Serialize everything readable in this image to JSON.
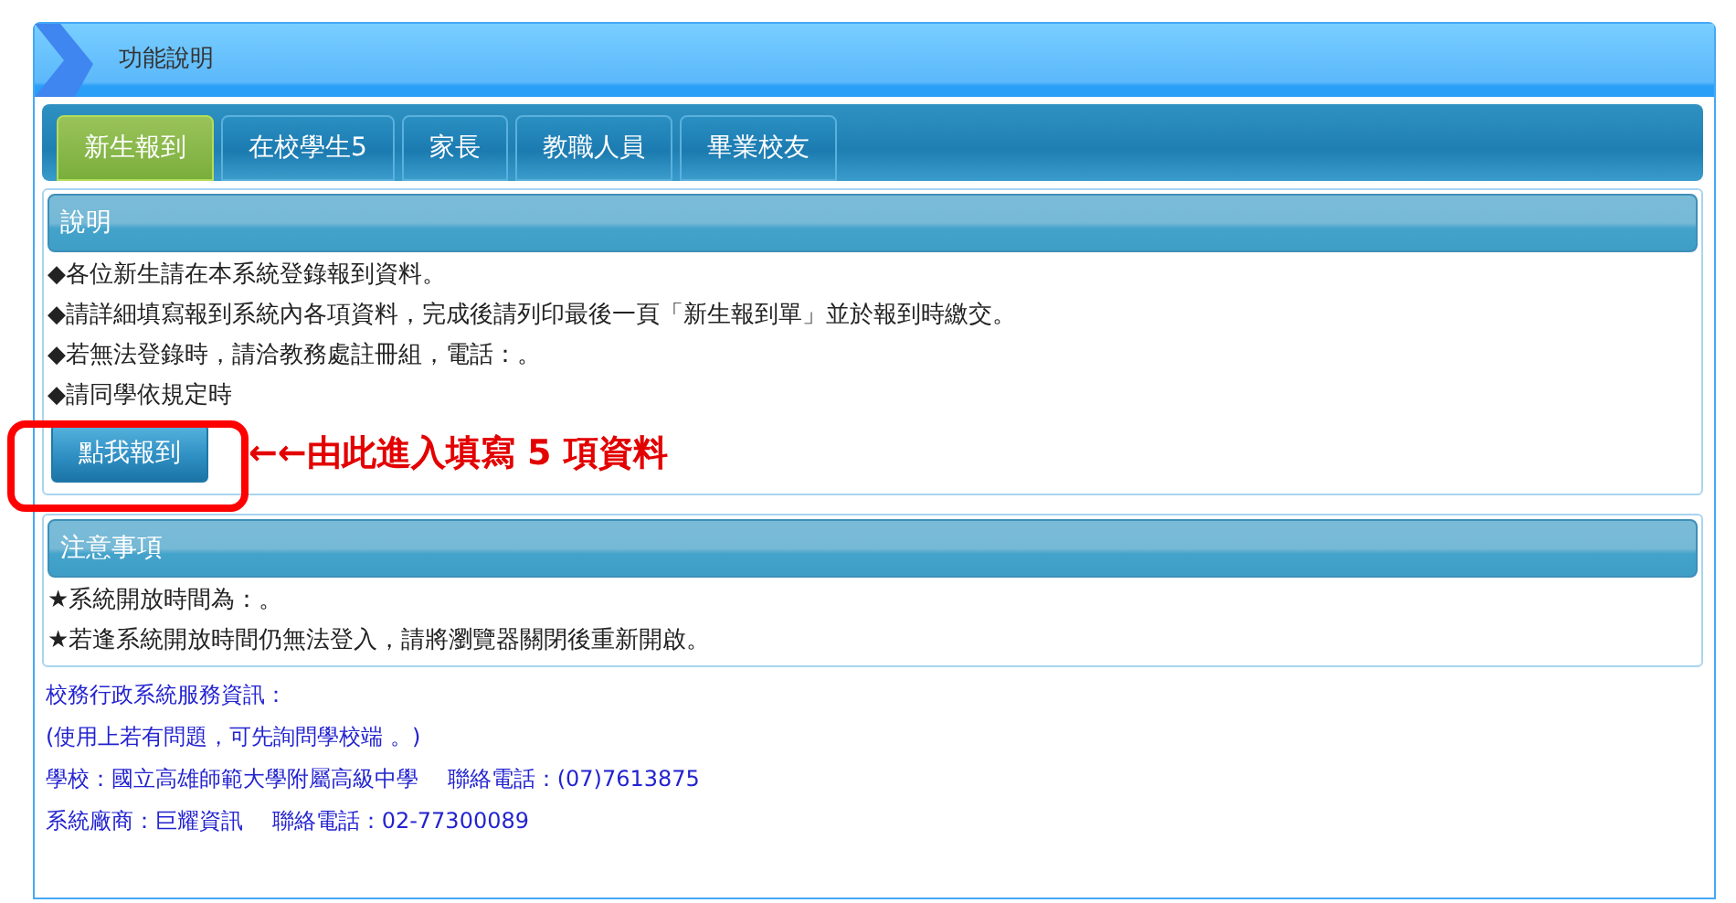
{
  "window": {
    "title": "功能說明"
  },
  "tabs": [
    {
      "label": "新生報到",
      "selected": true
    },
    {
      "label": "在校學生5",
      "selected": false
    },
    {
      "label": "家長",
      "selected": false
    },
    {
      "label": "教職人員",
      "selected": false
    },
    {
      "label": "畢業校友",
      "selected": false
    }
  ],
  "description": {
    "heading": "說明",
    "lines": [
      "◆各位新生請在本系統登錄報到資料。",
      "◆請詳細填寫報到系統內各項資料，完成後請列印最後一頁「新生報到單」並於報到時繳交。",
      "◆若無法登錄時，請洽教務處註冊組，電話：。",
      "◆請同學依規定時"
    ],
    "button": "點我報到",
    "annotation": "←←由此進入填寫 5 項資料"
  },
  "notes": {
    "heading": "注意事項",
    "lines": [
      "★系統開放時間為：。",
      "★若逢系統開放時間仍無法登入，請將瀏覽器關閉後重新開啟。"
    ]
  },
  "service_info": [
    "校務行政系統服務資訊：",
    "(使用上若有問題，可先詢問學校端 。)",
    "學校：國立高雄師範大學附屬高級中學　 聯絡電話：(07)7613875",
    "系統廠商：巨耀資訊　 聯絡電話：02-77300089"
  ]
}
